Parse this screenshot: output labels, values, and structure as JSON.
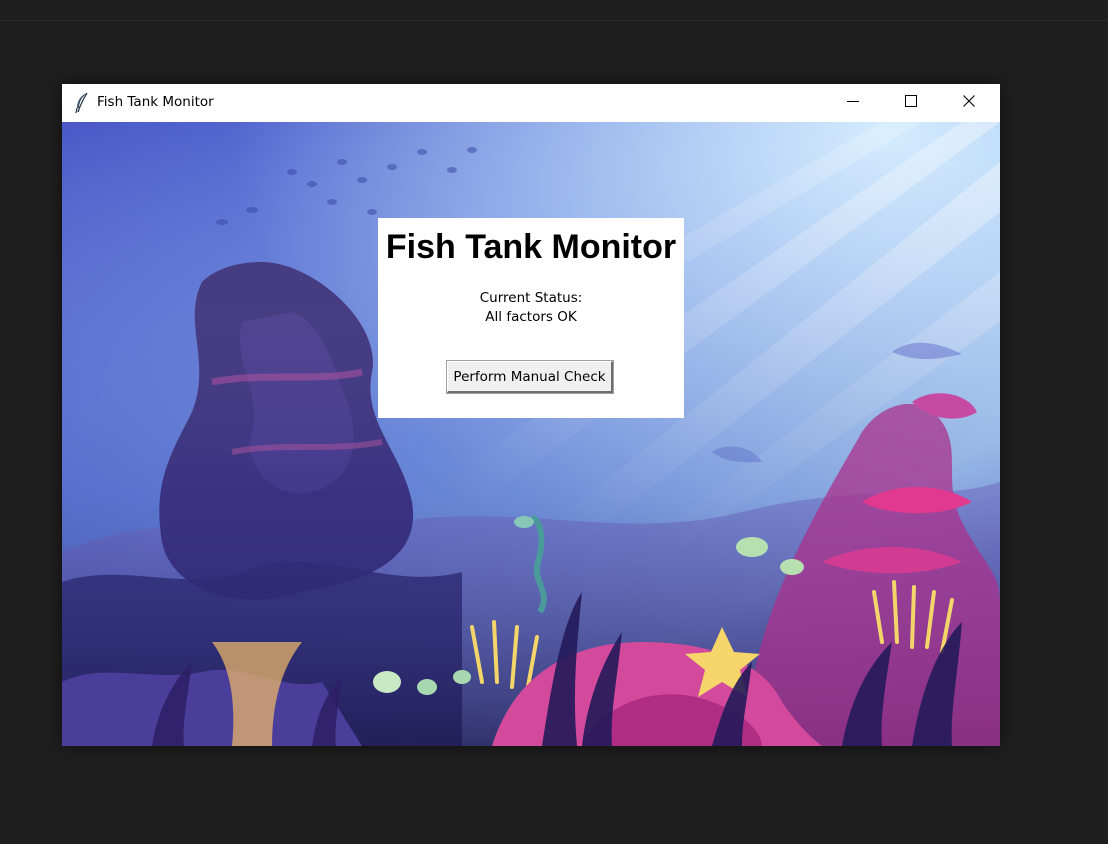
{
  "window": {
    "title": "Fish Tank Monitor"
  },
  "main": {
    "heading": "Fish Tank Monitor",
    "status_label": "Current Status:",
    "status_value": "All factors OK",
    "check_button_label": "Perform Manual Check"
  },
  "icons": {
    "app": "feather-icon",
    "minimize": "minimize-icon",
    "maximize": "maximize-icon",
    "close": "close-icon"
  },
  "colors": {
    "desktop": "#1f1f1f",
    "titlebar": "#ffffff",
    "water_top": "#8ec4f4",
    "water_mid": "#5a74d6",
    "water_deep": "#2a2466",
    "coral_pink": "#e0398f",
    "coral_yellow": "#f3d56a"
  }
}
